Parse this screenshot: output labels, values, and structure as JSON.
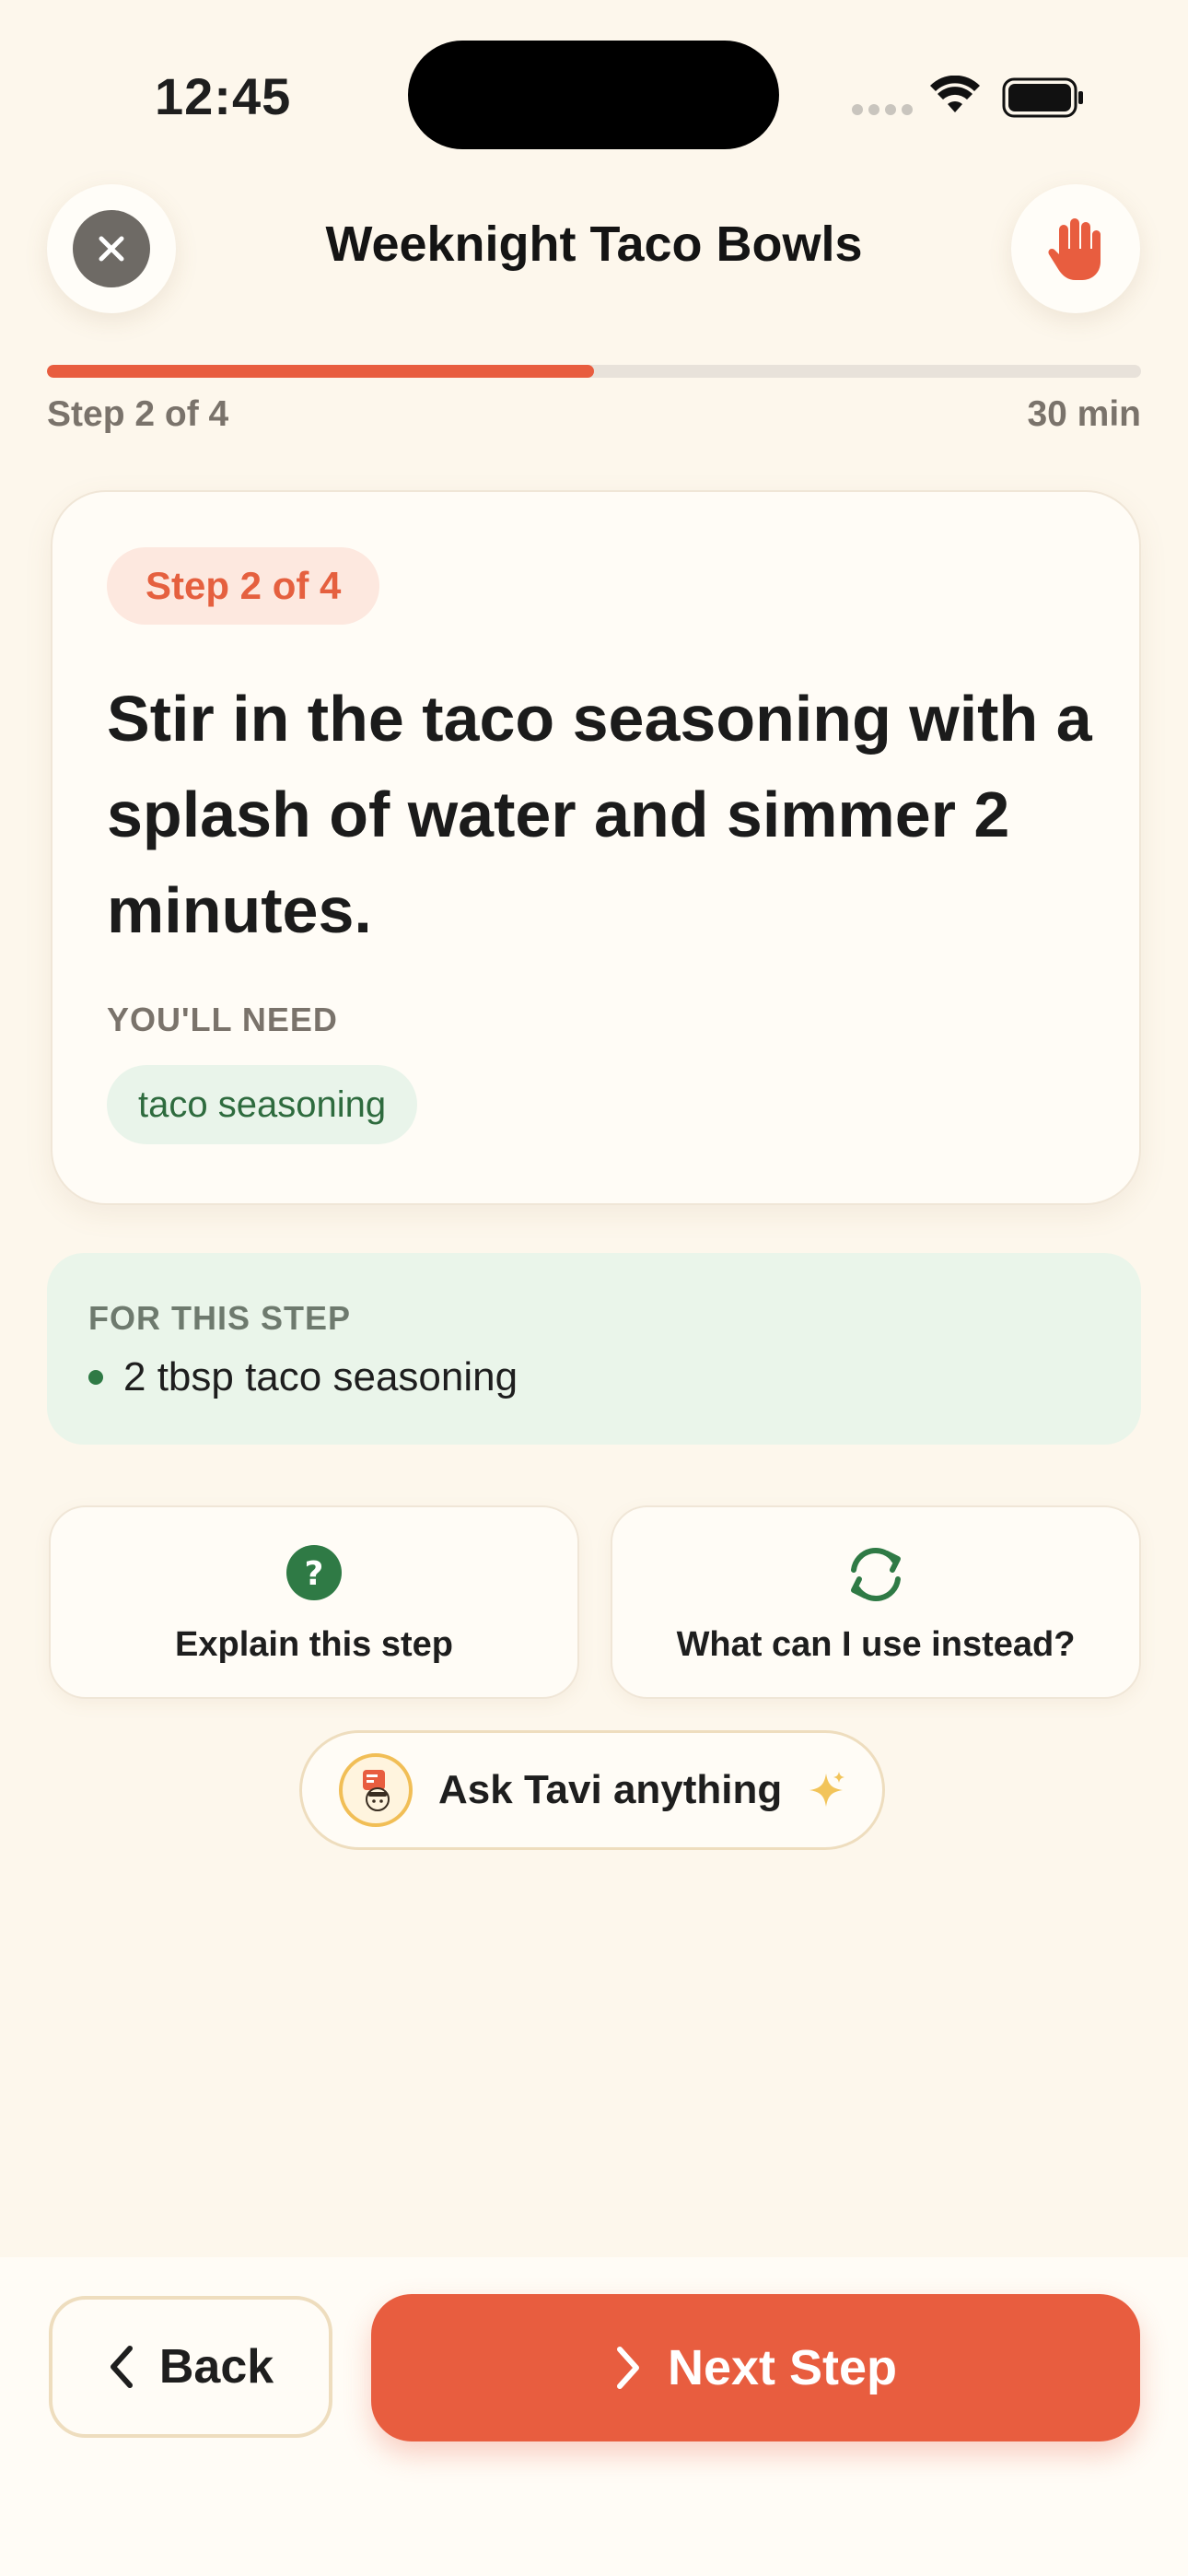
{
  "status_bar": {
    "time": "12:45"
  },
  "header": {
    "title": "Weeknight Taco Bowls"
  },
  "progress": {
    "step_text": "Step 2 of 4",
    "time_text": "30 min",
    "fraction": 0.5
  },
  "card": {
    "step_pill": "Step 2 of 4",
    "instruction": "Stir in the taco seasoning with a splash of water and simmer 2 minutes.",
    "need_label": "YOU'LL NEED",
    "need_items": [
      "taco seasoning"
    ]
  },
  "for_step": {
    "label": "FOR THIS STEP",
    "ingredients": [
      "2 tbsp taco seasoning"
    ]
  },
  "actions": {
    "explain_label": "Explain this step",
    "substitute_label": "What can I use instead?"
  },
  "ask": {
    "label": "Ask Tavi anything"
  },
  "nav": {
    "back_label": "Back",
    "next_label": "Next Step"
  },
  "colors": {
    "accent": "#E85D3F",
    "background": "#FDF7EC",
    "green": "#2F7A45"
  },
  "icons": {
    "close": "close-icon",
    "stop": "hand-stop-icon",
    "help": "question-icon",
    "substitute": "refresh-icon",
    "assistant": "chef-avatar-icon",
    "sparkle": "sparkle-icon",
    "back": "chevron-left-icon",
    "next": "chevron-right-icon"
  }
}
